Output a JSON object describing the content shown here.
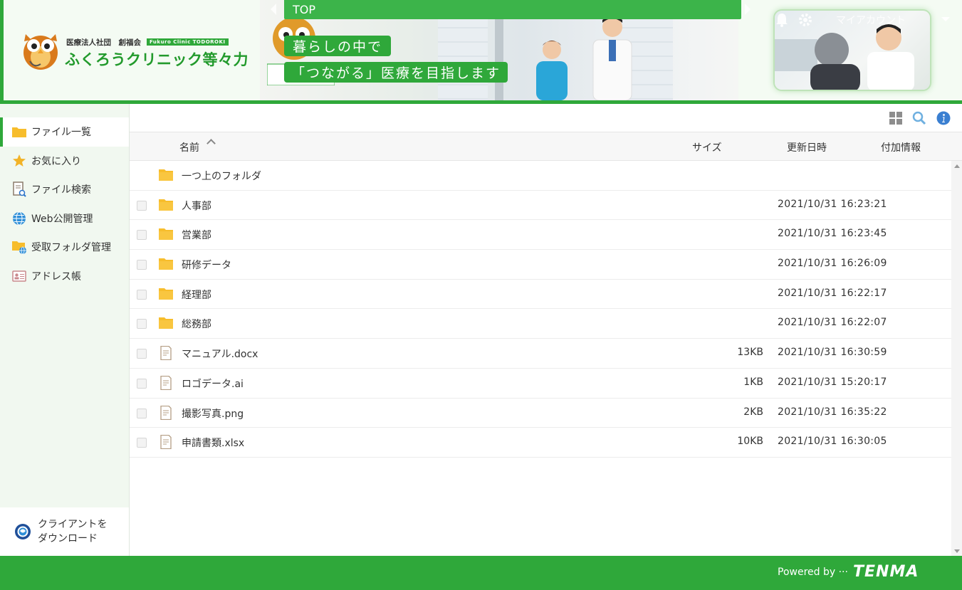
{
  "header": {
    "org_line": "医療法人社団　創福会",
    "org_en": "Fukuro Clinic TODOROKI",
    "clinic_name": "ふくろうクリニック等々力",
    "topbar_label": "TOP",
    "slide_line1": "暮らしの中で",
    "slide_line2": "「つながる」医療を目指します",
    "account_label": "マイアカウント"
  },
  "sidebar": {
    "items": [
      {
        "label": "ファイル一覧",
        "icon": "folder-icon"
      },
      {
        "label": "お気に入り",
        "icon": "star-icon"
      },
      {
        "label": "ファイル検索",
        "icon": "file-search-icon"
      },
      {
        "label": "Web公開管理",
        "icon": "globe-icon"
      },
      {
        "label": "受取フォルダ管理",
        "icon": "folder-globe-icon"
      },
      {
        "label": "アドレス帳",
        "icon": "address-book-icon"
      }
    ],
    "client_download_line1": "クライアントを",
    "client_download_line2": "ダウンロード"
  },
  "table": {
    "columns": {
      "name": "名前",
      "size": "サイズ",
      "updated": "更新日時",
      "extra": "付加情報"
    },
    "parent_folder": "一つ上のフォルダ",
    "rows": [
      {
        "name": "人事部",
        "type": "folder",
        "size": "",
        "updated": "2021/10/31 16:23:21"
      },
      {
        "name": "営業部",
        "type": "folder",
        "size": "",
        "updated": "2021/10/31 16:23:45"
      },
      {
        "name": "研修データ",
        "type": "folder",
        "size": "",
        "updated": "2021/10/31 16:26:09"
      },
      {
        "name": "経理部",
        "type": "folder",
        "size": "",
        "updated": "2021/10/31 16:22:17"
      },
      {
        "name": "総務部",
        "type": "folder",
        "size": "",
        "updated": "2021/10/31 16:22:07"
      },
      {
        "name": "マニュアル.docx",
        "type": "file",
        "size": "13KB",
        "updated": "2021/10/31 16:30:59"
      },
      {
        "name": "ロゴデータ.ai",
        "type": "file",
        "size": "1KB",
        "updated": "2021/10/31 15:20:17"
      },
      {
        "name": "撮影写真.png",
        "type": "file",
        "size": "2KB",
        "updated": "2021/10/31 16:35:22"
      },
      {
        "name": "申請書類.xlsx",
        "type": "file",
        "size": "10KB",
        "updated": "2021/10/31 16:30:05"
      }
    ]
  },
  "footer": {
    "powered_by": "Powered by ···",
    "brand": "TENMA"
  },
  "colors": {
    "brand_green": "#2fa83a",
    "folder_yellow": "#f7bd2c",
    "sidebar_bg": "#f1f8f0"
  }
}
